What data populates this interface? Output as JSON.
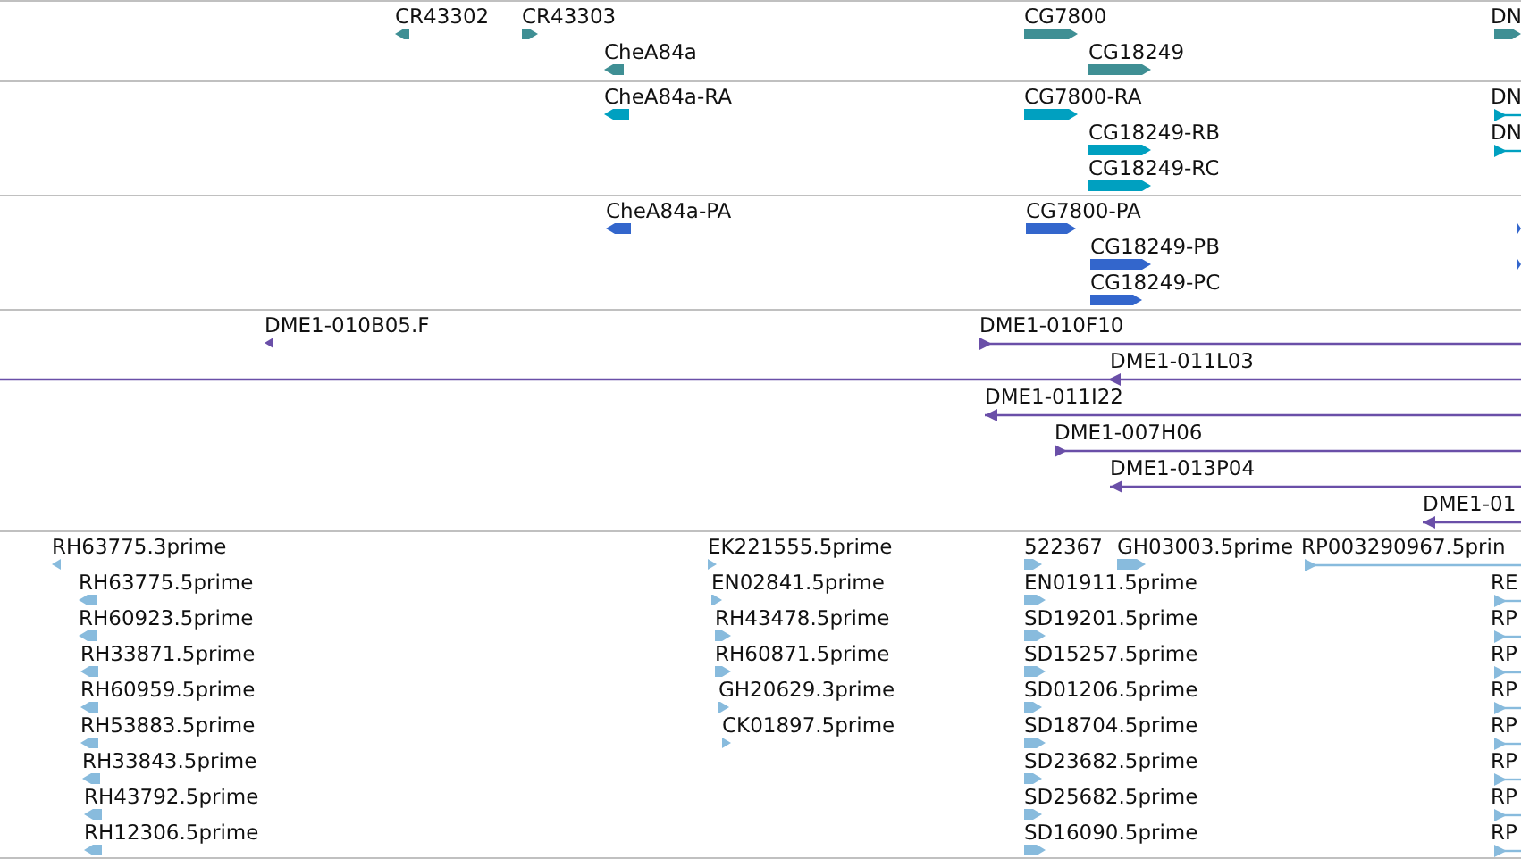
{
  "tracks": [
    {
      "color": "#3f8f94",
      "features": [
        {
          "label": "CR43302",
          "reverse": true,
          "kind": "block"
        },
        {
          "label": "CR43303",
          "reverse": false,
          "kind": "block"
        },
        {
          "label": "CheA84a",
          "reverse": true,
          "kind": "block"
        },
        {
          "label": "CG7800",
          "reverse": false,
          "kind": "block"
        },
        {
          "label": "CG18249",
          "reverse": false,
          "kind": "block"
        },
        {
          "label": "DN",
          "reverse": false,
          "kind": "block"
        }
      ]
    },
    {
      "color": "#00a0c0",
      "features": [
        {
          "label": "CheA84a-RA",
          "reverse": true,
          "kind": "block"
        },
        {
          "label": "CG7800-RA",
          "reverse": false,
          "kind": "block"
        },
        {
          "label": "CG18249-RB",
          "reverse": false,
          "kind": "block"
        },
        {
          "label": "CG18249-RC",
          "reverse": false,
          "kind": "block"
        },
        {
          "label": "DN",
          "reverse": false,
          "kind": "line"
        },
        {
          "label": "DN",
          "reverse": false,
          "kind": "line"
        }
      ]
    },
    {
      "color": "#3366cc",
      "features": [
        {
          "label": "CheA84a-PA",
          "reverse": true,
          "kind": "block"
        },
        {
          "label": "CG7800-PA",
          "reverse": false,
          "kind": "block"
        },
        {
          "label": "CG18249-PB",
          "reverse": false,
          "kind": "block"
        },
        {
          "label": "CG18249-PC",
          "reverse": false,
          "kind": "block"
        },
        {
          "reverse": false,
          "kind": "block"
        },
        {
          "reverse": false,
          "kind": "block"
        }
      ]
    },
    {
      "color": "#6a4fa8",
      "features": [
        {
          "label": "DME1-010B05.F",
          "reverse": true,
          "kind": "block"
        },
        {
          "label": "DME1-010F10",
          "reverse": false,
          "kind": "line"
        },
        {
          "label": "DME1-011L03",
          "reverse": true,
          "kind": "line"
        },
        {
          "label": "DME1-011I22",
          "reverse": true,
          "kind": "line"
        },
        {
          "label": "DME1-007H06",
          "reverse": false,
          "kind": "line"
        },
        {
          "label": "DME1-013P04",
          "reverse": true,
          "kind": "line"
        },
        {
          "label": "DME1-01",
          "reverse": true,
          "kind": "line"
        }
      ]
    },
    {
      "color": "#88bbdd",
      "features": [
        {
          "label": "RH63775.3prime",
          "reverse": true,
          "kind": "block"
        },
        {
          "label": "RH63775.5prime",
          "reverse": true,
          "kind": "block"
        },
        {
          "label": "RH60923.5prime",
          "reverse": true,
          "kind": "block"
        },
        {
          "label": "RH33871.5prime",
          "reverse": true,
          "kind": "block"
        },
        {
          "label": "RH60959.5prime",
          "reverse": true,
          "kind": "block"
        },
        {
          "label": "RH53883.5prime",
          "reverse": true,
          "kind": "block"
        },
        {
          "label": "RH33843.5prime",
          "reverse": true,
          "kind": "block"
        },
        {
          "label": "RH43792.5prime",
          "reverse": true,
          "kind": "block"
        },
        {
          "label": "RH12306.5prime",
          "reverse": true,
          "kind": "block"
        },
        {
          "label": "EK221555.5prime",
          "reverse": false,
          "kind": "block"
        },
        {
          "label": "EN02841.5prime",
          "reverse": false,
          "kind": "block"
        },
        {
          "label": "RH43478.5prime",
          "reverse": false,
          "kind": "block"
        },
        {
          "label": "RH60871.5prime",
          "reverse": false,
          "kind": "block"
        },
        {
          "label": "GH20629.3prime",
          "reverse": false,
          "kind": "block"
        },
        {
          "label": "CK01897.5prime",
          "reverse": false,
          "kind": "block"
        },
        {
          "label": "522367",
          "reverse": false,
          "kind": "block"
        },
        {
          "label": "GH03003.5prime",
          "reverse": false,
          "kind": "block"
        },
        {
          "label": "RP003290967.5prin",
          "reverse": false,
          "kind": "line"
        },
        {
          "label": "EN01911.5prime",
          "reverse": false,
          "kind": "block"
        },
        {
          "label": "SD19201.5prime",
          "reverse": false,
          "kind": "block"
        },
        {
          "label": "SD15257.5prime",
          "reverse": false,
          "kind": "block"
        },
        {
          "label": "SD01206.5prime",
          "reverse": false,
          "kind": "block"
        },
        {
          "label": "SD18704.5prime",
          "reverse": false,
          "kind": "block"
        },
        {
          "label": "SD23682.5prime",
          "reverse": false,
          "kind": "block"
        },
        {
          "label": "SD25682.5prime",
          "reverse": false,
          "kind": "block"
        },
        {
          "label": "SD16090.5prime",
          "reverse": false,
          "kind": "block"
        },
        {
          "label": "RE",
          "reverse": false,
          "kind": "line"
        },
        {
          "label": "RP",
          "reverse": false,
          "kind": "line"
        },
        {
          "label": "RP",
          "reverse": false,
          "kind": "line"
        },
        {
          "label": "RP",
          "reverse": false,
          "kind": "line"
        },
        {
          "label": "RP",
          "reverse": false,
          "kind": "line"
        },
        {
          "label": "RP",
          "reverse": false,
          "kind": "line"
        },
        {
          "label": "RP",
          "reverse": false,
          "kind": "line"
        },
        {
          "label": "RP",
          "reverse": false,
          "kind": "line"
        }
      ]
    }
  ]
}
